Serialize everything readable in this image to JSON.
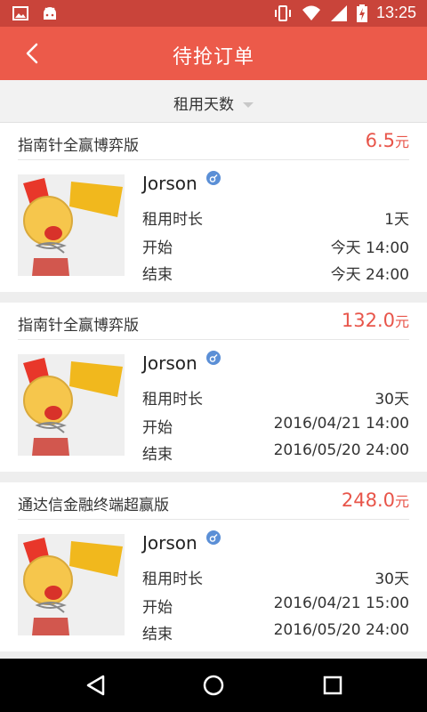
{
  "status_bar": {
    "time": "13:25",
    "left_icons": [
      "image-icon",
      "android-icon"
    ],
    "right_icons": [
      "vibrate-icon",
      "wifi-icon",
      "signal-icon",
      "battery-icon"
    ]
  },
  "app_bar": {
    "title": "待抢订单",
    "back_icon": "chevron-left-icon",
    "color": "#ec5a4a"
  },
  "filter": {
    "label": "租用天数"
  },
  "colors": {
    "price": "#e8554a",
    "gender": "#5b8fd6"
  },
  "orders": [
    {
      "product": "指南针全赢博弈版",
      "price": "6.5",
      "price_unit": "元",
      "user": "Jorson",
      "rows": [
        {
          "label": "租用时长",
          "value": "1天"
        },
        {
          "label": "开始",
          "value": "今天 14:00"
        },
        {
          "label": "结束",
          "value": "今天 24:00"
        }
      ]
    },
    {
      "product": "指南针全赢博弈版",
      "price": "132.0",
      "price_unit": "元",
      "user": "Jorson",
      "rows": [
        {
          "label": "租用时长",
          "value": "30天"
        },
        {
          "label": "开始",
          "value": "2016/04/21  14:00"
        },
        {
          "label": "结束",
          "value": "2016/05/20  24:00"
        }
      ]
    },
    {
      "product": "通达信金融终端超赢版",
      "price": "248.0",
      "price_unit": "元",
      "user": "Jorson",
      "rows": [
        {
          "label": "租用时长",
          "value": "30天"
        },
        {
          "label": "开始",
          "value": "2016/04/21  15:00"
        },
        {
          "label": "结束",
          "value": "2016/05/20  24:00"
        }
      ]
    }
  ],
  "nav_bar": [
    "back-triangle-icon",
    "home-circle-icon",
    "recents-square-icon"
  ]
}
